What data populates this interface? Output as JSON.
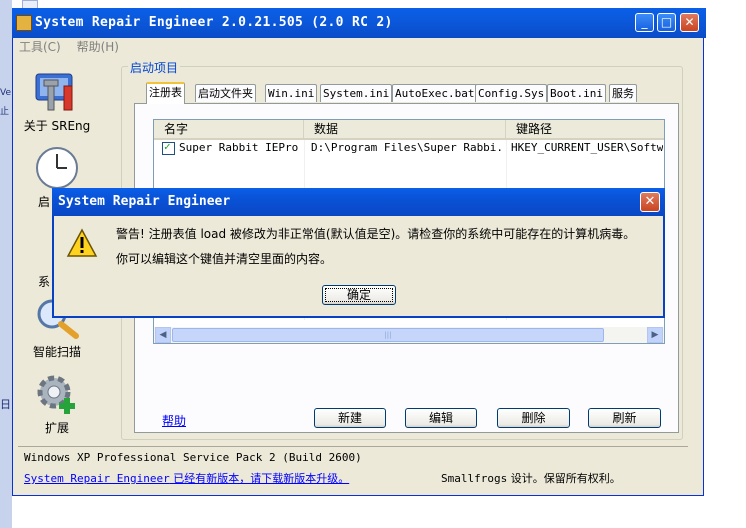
{
  "desktop": {
    "strip_text_1": "Ve",
    "strip_text_2": "止",
    "strip_text_3": "日"
  },
  "window": {
    "title": "System Repair Engineer 2.0.21.505 (2.0 RC 2)",
    "min": "_",
    "max": "□",
    "close": "✕"
  },
  "menu": {
    "tools": "工具(C)",
    "help": "帮助(H)"
  },
  "nav": [
    {
      "label": "关于 SREng",
      "icon": "tools-icon"
    },
    {
      "label": "启",
      "icon": "clock-icon"
    },
    {
      "label": "系",
      "icon": "system-icon"
    },
    {
      "label": "智能扫描",
      "icon": "magnifier-icon"
    },
    {
      "label": "扩展",
      "icon": "gear-plus-icon"
    }
  ],
  "group": {
    "legend": "启动项目"
  },
  "tabs": [
    "注册表",
    "启动文件夹",
    "Win.ini",
    "System.ini",
    "AutoExec.bat",
    "Config.Sys",
    "Boot.ini",
    "服务"
  ],
  "list": {
    "columns": [
      "名字",
      "数据",
      "键路径"
    ],
    "rows": [
      {
        "checked": true,
        "name": "Super Rabbit IEPro",
        "data": "D:\\Program Files\\Super Rabbi...",
        "path": "HKEY_CURRENT_USER\\Softwar"
      }
    ],
    "scroll_grip": "|||"
  },
  "actions": {
    "help": "帮助",
    "new": "新建",
    "edit": "编辑",
    "delete": "删除",
    "refresh": "刷新"
  },
  "status": {
    "os": "Windows XP Professional Service Pack 2 (Build 2600)",
    "update_prefix": "System Repair Engineer",
    "update_text": " 已经有新版本，请下载新版本升级。",
    "copyright_prefix": "Smallfrogs",
    "copyright_text": " 设计。保留所有权利。"
  },
  "dialog": {
    "title": "System Repair Engineer",
    "message1": "警告! 注册表值 load 被修改为非正常值(默认值是空)。请检查你的系统中可能存在的计算机病毒。",
    "message2": "你可以编辑这个键值并清空里面的内容。",
    "ok": "确定",
    "close": "✕"
  }
}
